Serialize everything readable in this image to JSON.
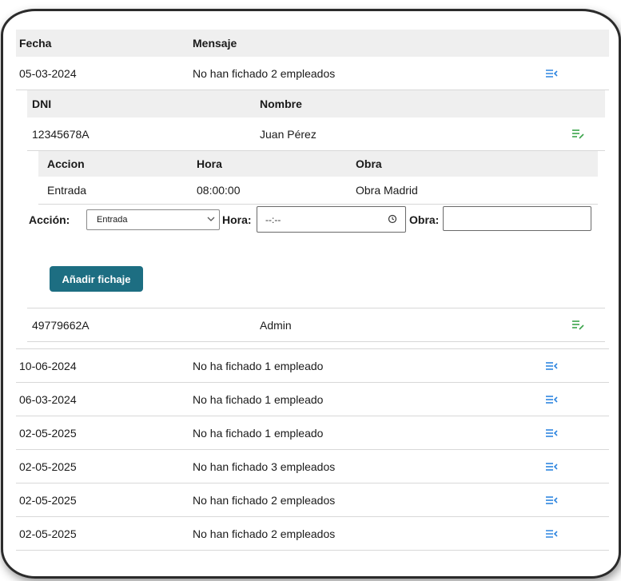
{
  "main_table": {
    "headers": {
      "fecha": "Fecha",
      "mensaje": "Mensaje"
    },
    "rows": [
      {
        "fecha": "05-03-2024",
        "mensaje": "No han fichado 2 empleados"
      },
      {
        "fecha": "10-06-2024",
        "mensaje": "No ha fichado 1 empleado"
      },
      {
        "fecha": "06-03-2024",
        "mensaje": "No ha fichado 1 empleado"
      },
      {
        "fecha": "02-05-2025",
        "mensaje": "No ha fichado 1 empleado"
      },
      {
        "fecha": "02-05-2025",
        "mensaje": "No han fichado 3 empleados"
      },
      {
        "fecha": "02-05-2025",
        "mensaje": "No han fichado 2 empleados"
      },
      {
        "fecha": "02-05-2025",
        "mensaje": "No han fichado 2 empleados"
      }
    ]
  },
  "employees_table": {
    "headers": {
      "dni": "DNI",
      "nombre": "Nombre"
    },
    "rows": [
      {
        "dni": "12345678A",
        "nombre": "Juan Pérez"
      },
      {
        "dni": "49779662A",
        "nombre": "Admin"
      }
    ]
  },
  "fichajes_table": {
    "headers": {
      "accion": "Accion",
      "hora": "Hora",
      "obra": "Obra"
    },
    "rows": [
      {
        "accion": "Entrada",
        "hora": "08:00:00",
        "obra": "Obra Madrid"
      }
    ]
  },
  "form": {
    "accion_label": "Acción:",
    "accion_value": "Entrada",
    "hora_label": "Hora:",
    "hora_placeholder": "--:--",
    "obra_label": "Obra:",
    "obra_value": "",
    "submit_label": "Añadir fichaje"
  },
  "icons": {
    "expand": "list-collapse-icon",
    "edit": "list-edit-icon",
    "dropdown": "chevron-down-icon",
    "clock": "clock-icon"
  },
  "colors": {
    "header_bg": "#efefef",
    "button_bg": "#1d6e82",
    "expand_icon": "#2f86e0",
    "edit_icon": "#3aa34a"
  }
}
